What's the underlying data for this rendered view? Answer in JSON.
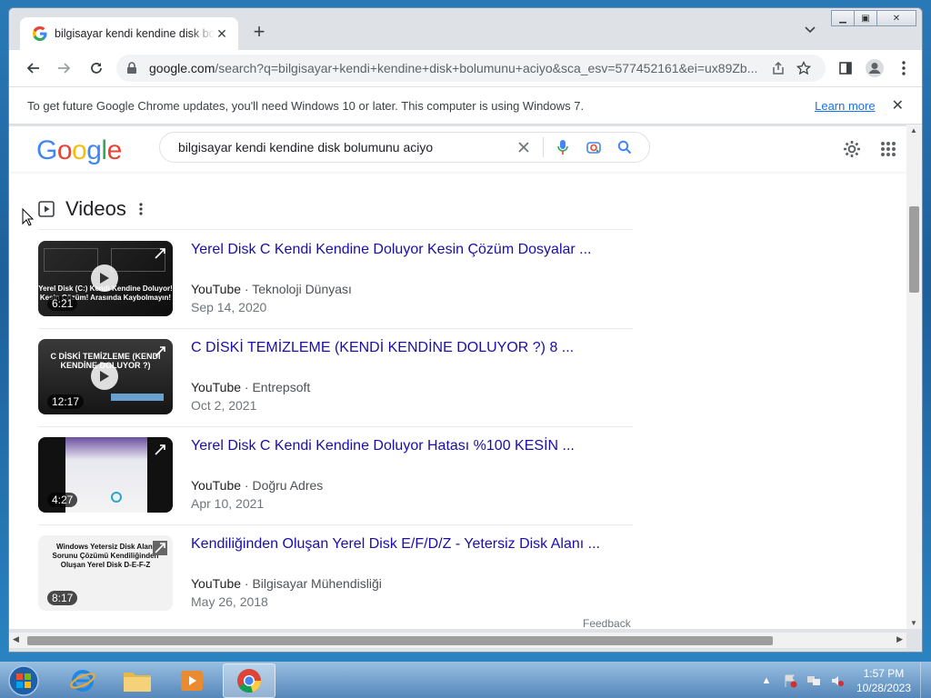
{
  "browser": {
    "tab_title": "bilgisayar kendi kendine disk bolumunu aciyo",
    "new_tab_label": "+",
    "url_host": "google.com",
    "url_rest": "/search?q=bilgisayar+kendi+kendine+disk+bolumunu+aciyo&sca_esv=577452161&ei=ux89Zb...",
    "window_controls": [
      "minimize",
      "maximize",
      "close"
    ]
  },
  "infobar": {
    "message": "To get future Google Chrome updates, you'll need Windows 10 or later. This computer is using Windows 7.",
    "link": "Learn more",
    "close": "✕"
  },
  "google": {
    "logo": "Google",
    "query": "bilgisayar kendi kendine disk bolumunu aciyo"
  },
  "videos": {
    "heading": "Videos",
    "items": [
      {
        "title": "Yerel Disk C Kendi Kendine Doluyor Kesin Çözüm Dosyalar ...",
        "site": "YouTube",
        "channel": "· Teknoloji Dünyası",
        "date": "Sep 14, 2020",
        "duration": "6:21",
        "thumb_caption": "Yerel Disk (C:) Kendi Kendine Doluyor! Kesin Çözüm! Arasında Kaybolmayın!"
      },
      {
        "title": "C DİSKİ TEMİZLEME (KENDİ KENDİNE DOLUYOR ?) 8 ...",
        "site": "YouTube",
        "channel": "· Entrepsoft",
        "date": "Oct 2, 2021",
        "duration": "12:17",
        "thumb_caption": "C DİSKİ TEMİZLEME (KENDİ KENDİNE DOLUYOR ?)"
      },
      {
        "title": "Yerel Disk C Kendi Kendine Doluyor Hatası %100 KESİN ...",
        "site": "YouTube",
        "channel": "· Doğru Adres",
        "date": "Apr 10, 2021",
        "duration": "4:27",
        "thumb_caption": ""
      },
      {
        "title": "Kendiliğinden Oluşan Yerel Disk E/F/D/Z - Yetersiz Disk Alanı ...",
        "site": "YouTube",
        "channel": "· Bilgisayar Mühendisliği",
        "date": "May 26, 2018",
        "duration": "8:17",
        "thumb_caption": "Windows Yetersiz Disk Alanı Sorunu Çözümü Kendiliğinden Oluşan Yerel Disk D-E-F-Z"
      }
    ]
  },
  "feedback": "Feedback",
  "taskbar": {
    "time": "1:57 PM",
    "date": "10/28/2023",
    "apps": [
      "internet-explorer",
      "file-explorer",
      "media-player",
      "chrome"
    ]
  }
}
